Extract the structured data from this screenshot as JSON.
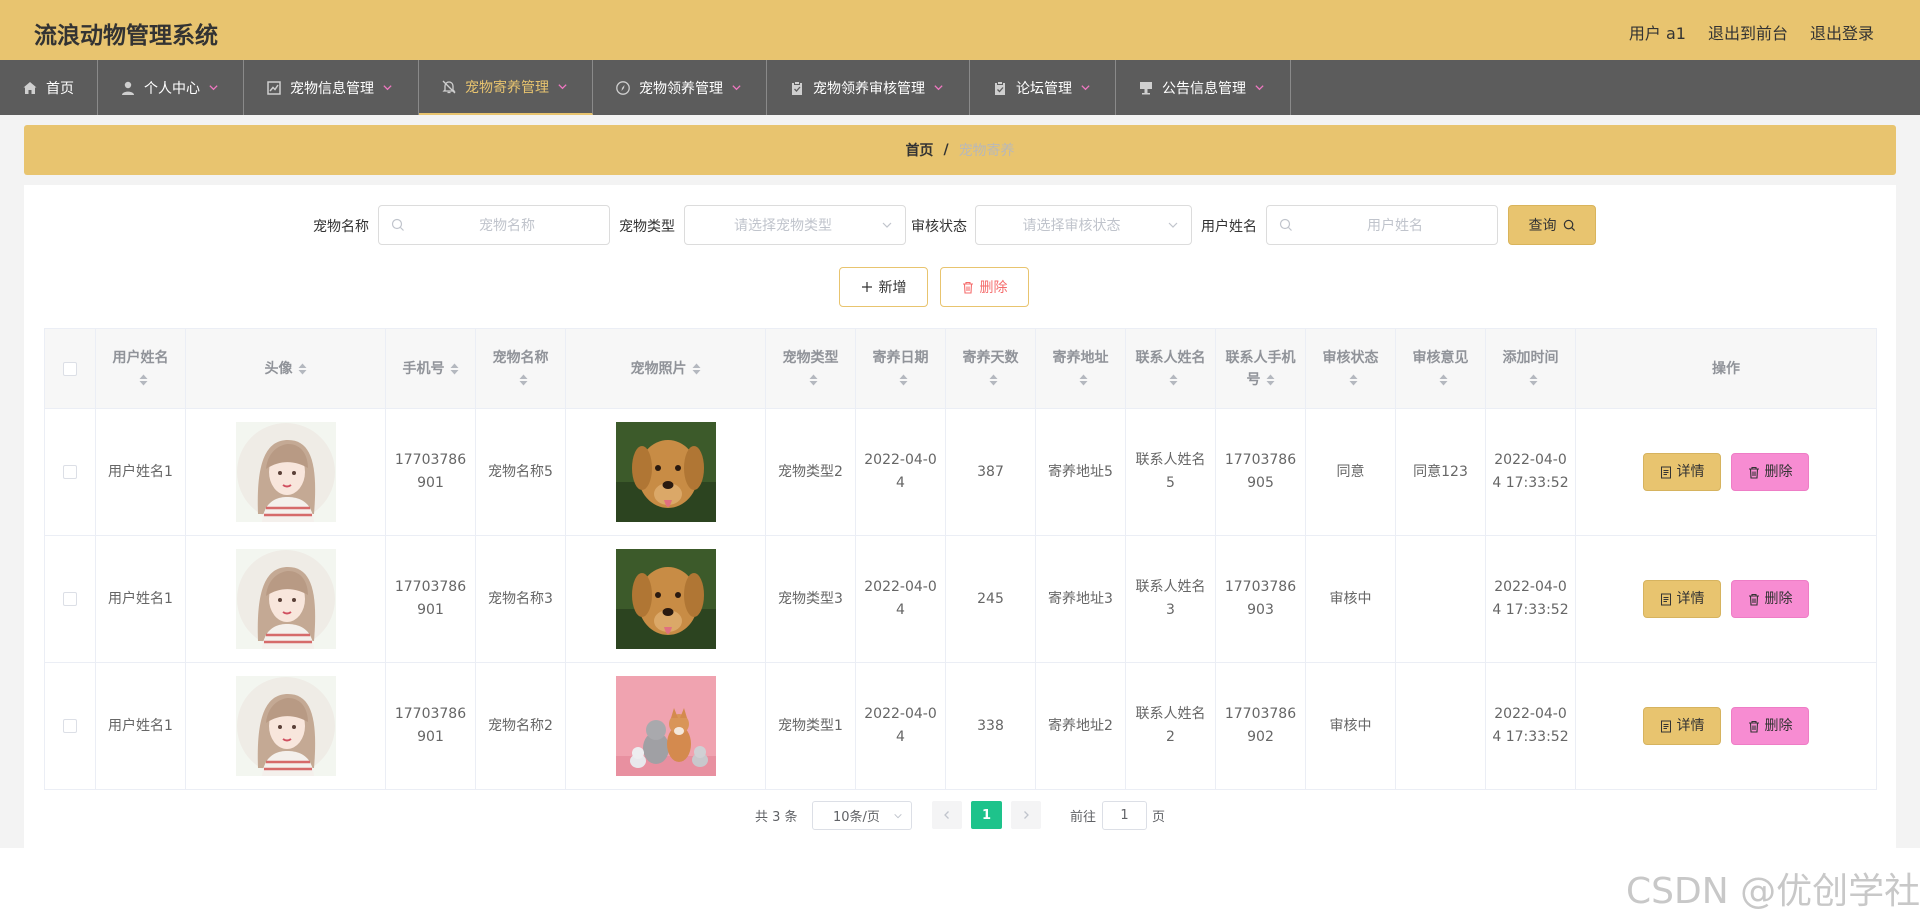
{
  "app": {
    "title": "流浪动物管理系统",
    "user_label": "用户 a1",
    "front_link": "退出到前台",
    "logout_link": "退出登录"
  },
  "nav": {
    "items": [
      {
        "label": "首页",
        "icon": "home-icon"
      },
      {
        "label": "个人中心",
        "icon": "user-icon"
      },
      {
        "label": "宠物信息管理",
        "icon": "chart-icon"
      },
      {
        "label": "宠物寄养管理",
        "icon": "bell-off-icon"
      },
      {
        "label": "宠物领养管理",
        "icon": "compass-icon"
      },
      {
        "label": "宠物领养审核管理",
        "icon": "clipboard-icon"
      },
      {
        "label": "论坛管理",
        "icon": "clipboard-check-icon"
      },
      {
        "label": "公告信息管理",
        "icon": "megaphone-icon"
      }
    ],
    "active_index": 3
  },
  "breadcrumb": {
    "home": "首页",
    "separator": "/",
    "current": "宠物寄养"
  },
  "search": {
    "pet_name_label": "宠物名称",
    "pet_name_placeholder": "宠物名称",
    "pet_type_label": "宠物类型",
    "pet_type_placeholder": "请选择宠物类型",
    "status_label": "审核状态",
    "status_placeholder": "请选择审核状态",
    "user_label": "用户姓名",
    "user_placeholder": "用户姓名",
    "query_button": "查询"
  },
  "actions": {
    "add_button": "新增",
    "delete_button": "删除"
  },
  "table": {
    "headers": [
      "用户姓名",
      "头像",
      "手机号",
      "宠物名称",
      "宠物照片",
      "宠物类型",
      "寄养日期",
      "寄养天数",
      "寄养地址",
      "联系人姓名",
      "联系人手机号",
      "审核状态",
      "审核意见",
      "添加时间",
      "操作"
    ],
    "detail_label": "详情",
    "delete_label": "删除",
    "rows": [
      {
        "user": "用户姓名1",
        "phone": "17703786901",
        "pet_name": "宠物名称5",
        "photo": "golden-retriever",
        "pet_type": "宠物类型2",
        "date": "2022-04-04",
        "days": "387",
        "address": "寄养地址5",
        "contact": "联系人姓名5",
        "contact_phone": "17703786905",
        "status": "同意",
        "opinion": "同意123",
        "added": "2022-04-04 17:33:52"
      },
      {
        "user": "用户姓名1",
        "phone": "17703786901",
        "pet_name": "宠物名称3",
        "photo": "golden-retriever",
        "pet_type": "宠物类型3",
        "date": "2022-04-04",
        "days": "245",
        "address": "寄养地址3",
        "contact": "联系人姓名3",
        "contact_phone": "17703786903",
        "status": "审核中",
        "opinion": "",
        "added": "2022-04-04 17:33:52"
      },
      {
        "user": "用户姓名1",
        "phone": "17703786901",
        "pet_name": "宠物名称2",
        "photo": "pets-on-pink",
        "pet_type": "宠物类型1",
        "date": "2022-04-04",
        "days": "338",
        "address": "寄养地址2",
        "contact": "联系人姓名2",
        "contact_phone": "17703786902",
        "status": "审核中",
        "opinion": "",
        "added": "2022-04-04 17:33:52"
      }
    ]
  },
  "pagination": {
    "total": "共 3 条",
    "page_size": "10条/页",
    "current_page": "1",
    "goto_label": "前往",
    "goto_value": "1",
    "page_unit": "页"
  },
  "watermark": "CSDN @优创学社",
  "colors": {
    "accent": "#e8c46f",
    "nav_bg": "#5c5c5c",
    "delete_pink": "#f78cd2",
    "page_active": "#1ec38b"
  }
}
